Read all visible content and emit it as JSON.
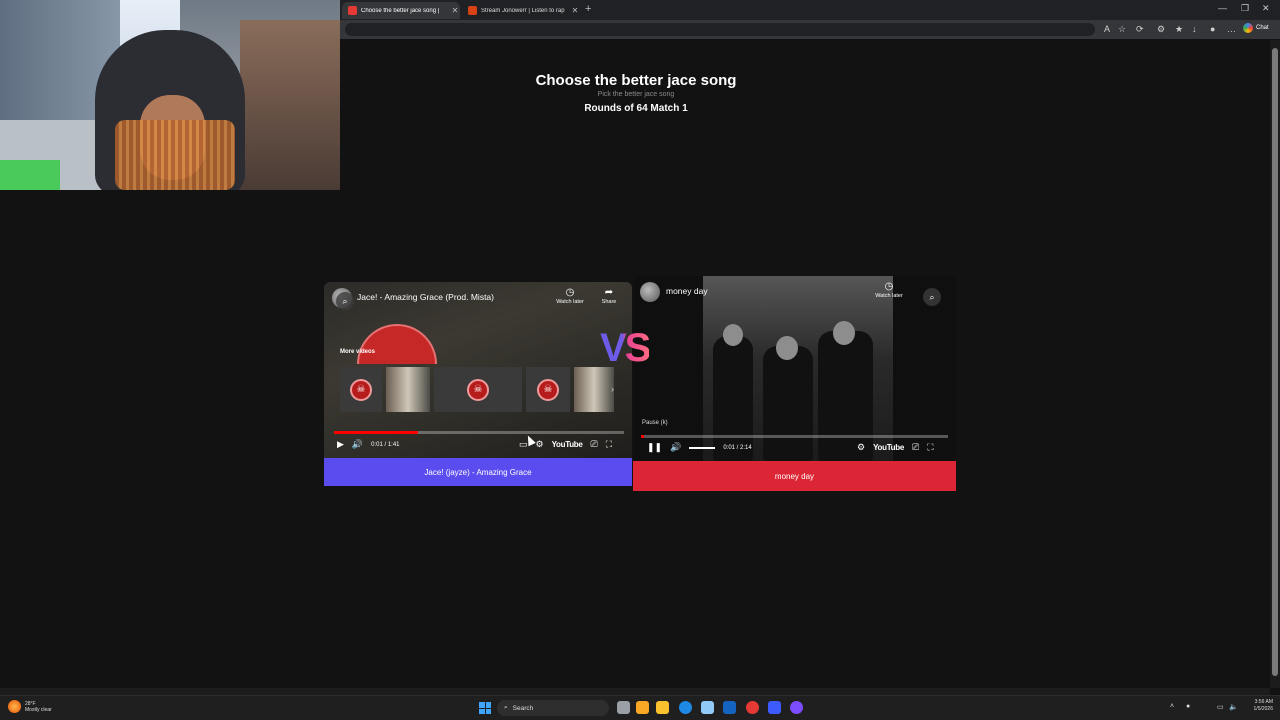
{
  "browser": {
    "tabs": [
      {
        "label": "Choose the better jace song |",
        "active": true
      },
      {
        "label": "Stream Jonowerr | Listen to rap pl",
        "active": false
      }
    ],
    "chat_label": "Chat"
  },
  "page": {
    "title": "Choose the better jace song",
    "subtitle": "Pick the better jace song",
    "round": "Rounds of 64 Match 1",
    "vs": "VS"
  },
  "left_video": {
    "title": "Jace! - Amazing Grace (Prod. Mista)",
    "watch_later": "Watch later",
    "share": "Share",
    "more_videos": "More videos",
    "time": "0:01 / 1:41",
    "youtube": "YouTube",
    "progress": 0.29,
    "choice_label": "Jace! (jayze) - Amazing Grace"
  },
  "right_video": {
    "title": "money day",
    "watch_later": "Watch later",
    "pause_tip": "Pause (k)",
    "time": "0:01 / 2:14",
    "youtube": "YouTube",
    "progress": 0.01,
    "choice_label": "money day"
  },
  "taskbar": {
    "weather_temp": "28°F",
    "weather_desc": "Mostly clear",
    "search_label": "Search",
    "time": "3:56 AM",
    "date": "1/5/2026"
  },
  "colors": {
    "left_choice": "#5b4cf0",
    "right_choice": "#dc2535",
    "page_bg": "#121212"
  },
  "icons": [
    "play-icon",
    "pause-icon",
    "volume-icon",
    "settings-icon",
    "cast-icon",
    "fullscreen-icon",
    "clock-icon",
    "share-icon",
    "zoom-icon",
    "search-icon"
  ]
}
